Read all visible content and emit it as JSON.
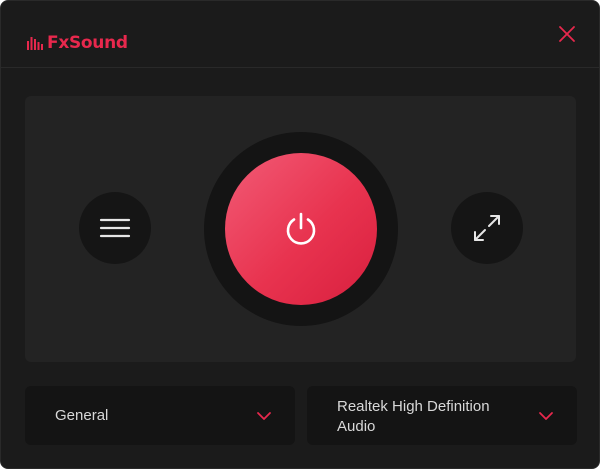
{
  "app": {
    "name": "FxSound",
    "accent_color": "#e8284d"
  },
  "titlebar": {
    "logo_icon": "sound-bars-icon",
    "close_icon": "close-icon"
  },
  "controls": {
    "menu_icon": "hamburger-menu-icon",
    "power_icon": "power-icon",
    "expand_icon": "expand-icon"
  },
  "preset_dropdown": {
    "selected": "General",
    "icon": "chevron-down-icon"
  },
  "device_dropdown": {
    "selected": "Realtek High Definition Audio",
    "icon": "chevron-down-icon"
  }
}
